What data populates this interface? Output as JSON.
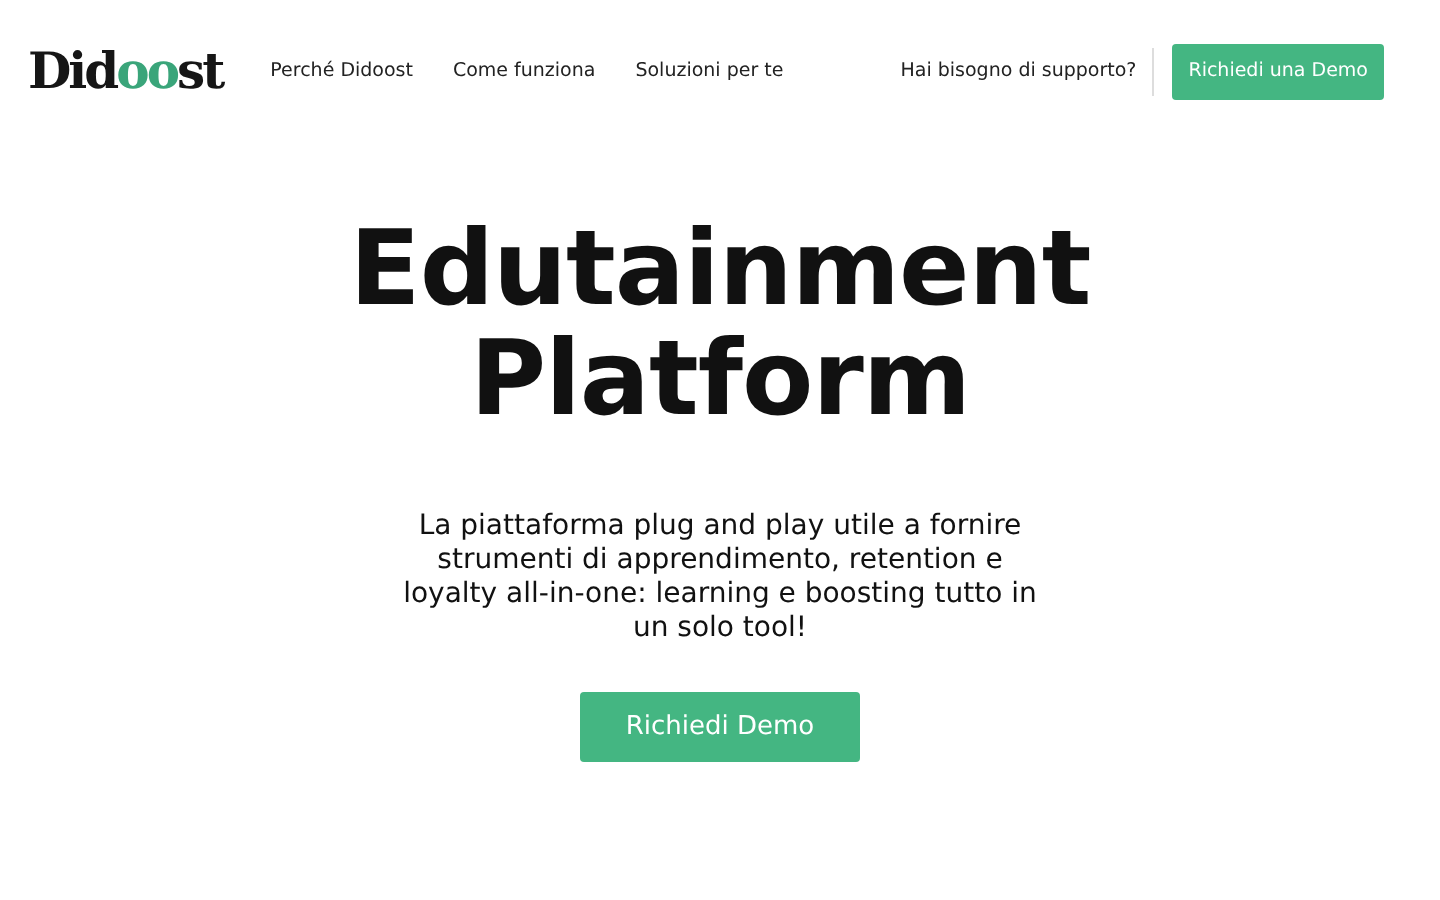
{
  "logo": [
    {
      "text": "Did",
      "accent": false
    },
    {
      "text": "oo",
      "accent": true
    },
    {
      "text": "st",
      "accent": false
    }
  ],
  "nav": [
    "Perché Didoost",
    "Come funziona",
    "Soluzioni per te"
  ],
  "support_link": "Hai bisogno di supporto?",
  "demo_button": "Richiedi una Demo",
  "hero": {
    "title": "Edutainment Platform",
    "subtitle": "La piattaforma plug and play utile a fornire strumenti di apprendimento, retention e loyalty all-in-one: learning e boosting tutto in un solo tool!",
    "button": "Richiedi Demo"
  }
}
